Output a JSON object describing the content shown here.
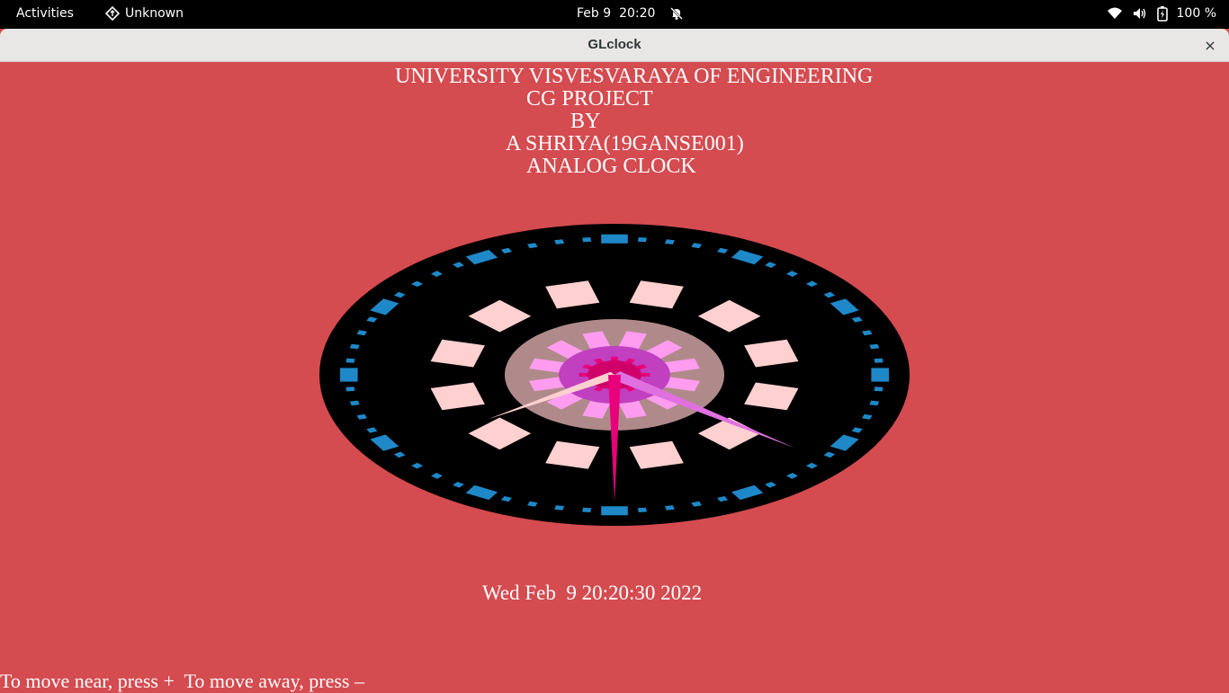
{
  "topbar": {
    "activities": "Activities",
    "app_name": "Unknown",
    "date": "Feb 9",
    "time": "20:20",
    "battery": "100 %",
    "icons": [
      "app-diamond-icon",
      "notifications-muted-icon",
      "wifi-icon",
      "volume-icon",
      "battery-icon"
    ]
  },
  "window": {
    "title": "GLclock",
    "close_symbol": "×"
  },
  "scene": {
    "header_lines": [
      "UNIVERSITY VISVESVARAYA OF ENGINEERING",
      "CG PROJECT",
      "BY",
      "A SHRIYA(19GANSE001)",
      "ANALOG CLOCK"
    ],
    "datetime": "Wed Feb  9 20:20:30 2022",
    "instructions": "To move near, press +  To move away, press –",
    "clock_time": {
      "hour": 20,
      "minute": 20,
      "second": 30
    },
    "colors": {
      "background": "#d44b50",
      "dial": "#000000",
      "tick_marks": "#1e88c8",
      "inner_disc": "#b08a8a",
      "pink_blocks": "#ffd0d0",
      "magenta": "#e8007a",
      "violet": "#c040c0"
    }
  }
}
